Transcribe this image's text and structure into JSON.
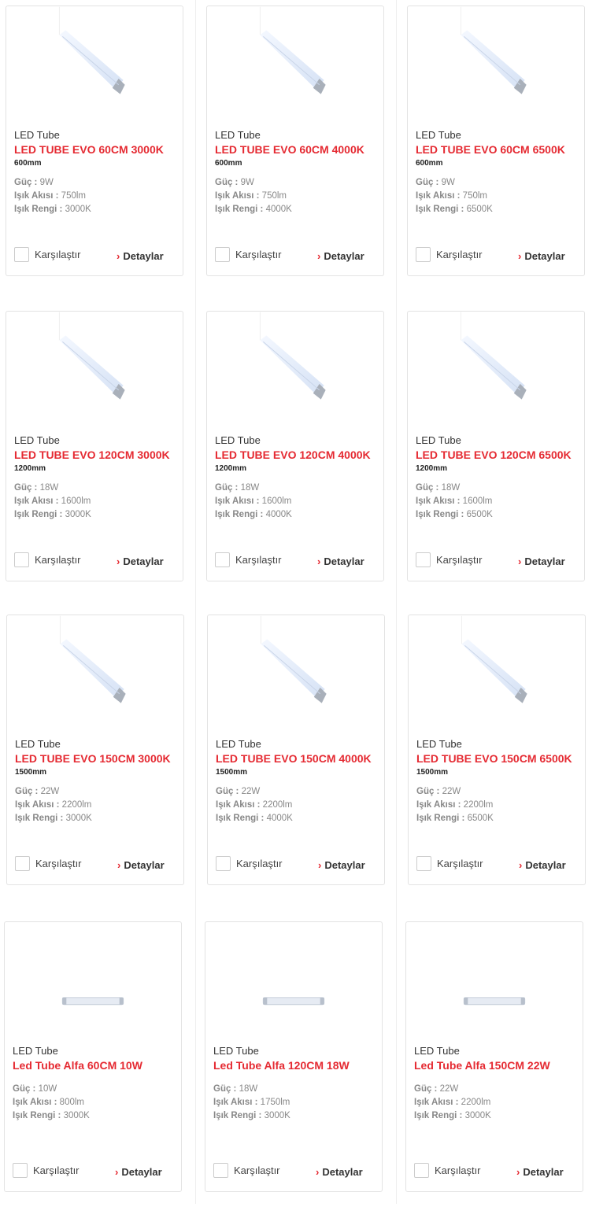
{
  "labels": {
    "compare": "Karşılaştır",
    "details": "Detaylar"
  },
  "spec_labels": {
    "power": "Güç :",
    "flux": "Işık Akısı :",
    "color": "Işık Rengi :"
  },
  "colors": {
    "accent": "#e52a32"
  },
  "products": [
    {
      "category": "LED Tube",
      "name": "LED TUBE EVO 60CM 3000K",
      "length": "600mm",
      "power": "9W",
      "flux": "750lm",
      "color": "3000K",
      "image": "evo-tube"
    },
    {
      "category": "LED Tube",
      "name": "LED TUBE EVO 60CM 4000K",
      "length": "600mm",
      "power": "9W",
      "flux": "750lm",
      "color": "4000K",
      "image": "evo-tube"
    },
    {
      "category": "LED Tube",
      "name": "LED TUBE EVO 60CM 6500K",
      "length": "600mm",
      "power": "9W",
      "flux": "750lm",
      "color": "6500K",
      "image": "evo-tube"
    },
    {
      "category": "LED Tube",
      "name": "LED TUBE EVO 120CM 3000K",
      "length": "1200mm",
      "power": "18W",
      "flux": "1600lm",
      "color": "3000K",
      "image": "evo-tube"
    },
    {
      "category": "LED Tube",
      "name": "LED TUBE EVO 120CM 4000K",
      "length": "1200mm",
      "power": "18W",
      "flux": "1600lm",
      "color": "4000K",
      "image": "evo-tube"
    },
    {
      "category": "LED Tube",
      "name": "LED TUBE EVO 120CM 6500K",
      "length": "1200mm",
      "power": "18W",
      "flux": "1600lm",
      "color": "6500K",
      "image": "evo-tube"
    },
    {
      "category": "LED Tube",
      "name": "LED TUBE EVO 150CM 3000K",
      "length": "1500mm",
      "power": "22W",
      "flux": "2200lm",
      "color": "3000K",
      "image": "evo-tube"
    },
    {
      "category": "LED Tube",
      "name": "LED TUBE EVO 150CM 4000K",
      "length": "1500mm",
      "power": "22W",
      "flux": "2200lm",
      "color": "4000K",
      "image": "evo-tube"
    },
    {
      "category": "LED Tube",
      "name": "LED TUBE EVO 150CM 6500K",
      "length": "1500mm",
      "power": "22W",
      "flux": "2200lm",
      "color": "6500K",
      "image": "evo-tube"
    },
    {
      "category": "LED Tube",
      "name": "Led Tube Alfa 60CM 10W",
      "length": "",
      "power": "10W",
      "flux": "800lm",
      "color": "3000K",
      "image": "alfa-tube"
    },
    {
      "category": "LED Tube",
      "name": "Led Tube Alfa 120CM 18W",
      "length": "",
      "power": "18W",
      "flux": "1750lm",
      "color": "3000K",
      "image": "alfa-tube"
    },
    {
      "category": "LED Tube",
      "name": "Led Tube Alfa 150CM 22W",
      "length": "",
      "power": "22W",
      "flux": "2200lm",
      "color": "3000K",
      "image": "alfa-tube"
    }
  ]
}
